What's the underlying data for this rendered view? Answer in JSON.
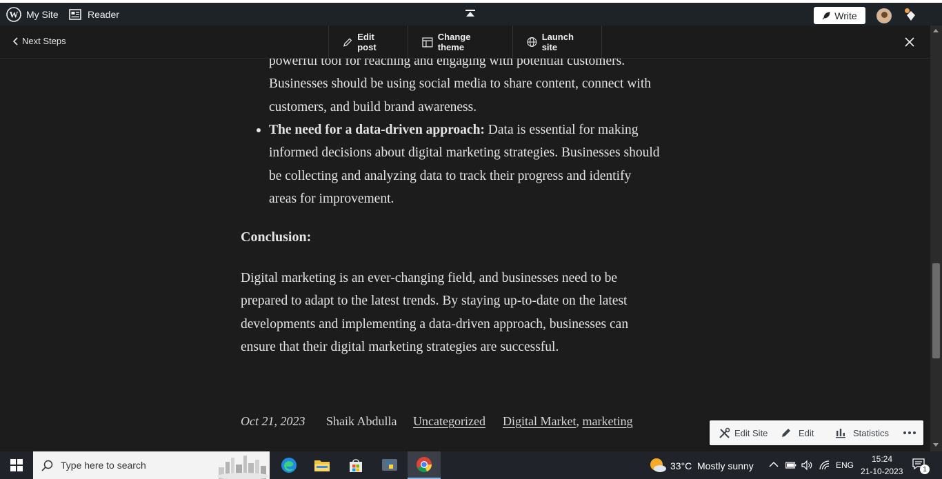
{
  "adminbar": {
    "my_site": "My Site",
    "reader": "Reader",
    "write": "Write"
  },
  "launchbar": {
    "next_steps": "Next Steps",
    "edit_post": "Edit post",
    "change_theme": "Change theme",
    "launch_site": "Launch site"
  },
  "article": {
    "bullet1_lines": [
      "powerful tool for reaching and engaging with potential customers.",
      "Businesses should be using social media to share content, connect with",
      "customers, and build brand awareness."
    ],
    "bullet2_bold": "The need for a data-driven approach:",
    "bullet2_line1_rest": " Data is essential for making",
    "bullet2_lines": [
      "informed decisions about digital marketing strategies. Businesses should",
      "be collecting and analyzing data to track their progress and identify",
      "areas for improvement."
    ],
    "conclusion_heading": "Conclusion:",
    "conclusion_lines": [
      "Digital marketing is an ever-changing field, and businesses need to be",
      "prepared to adapt to the latest trends. By staying up-to-date on the latest",
      "developments and implementing a data-driven approach, businesses can",
      "ensure that their digital marketing strategies are successful."
    ]
  },
  "meta": {
    "date": "Oct 21, 2023",
    "author": "Shaik Abdulla",
    "category": "Uncategorized",
    "tag1": "Digital Market",
    "separator": ",",
    "tag2": "marketing"
  },
  "sitetools": {
    "edit_site": "Edit Site",
    "edit": "Edit",
    "statistics": "Statistics"
  },
  "taskbar": {
    "search_placeholder": "Type here to search",
    "weather_temp": "33°C",
    "weather_desc": "Mostly sunny",
    "language": "ENG",
    "time": "15:24",
    "date": "21-10-2023",
    "notification_count": "1"
  },
  "colors": {
    "adminbar_bg": "#1d2327",
    "content_bg": "#1c1c1c",
    "text": "#e4e4e4",
    "taskbar_bg": "#20232a"
  }
}
